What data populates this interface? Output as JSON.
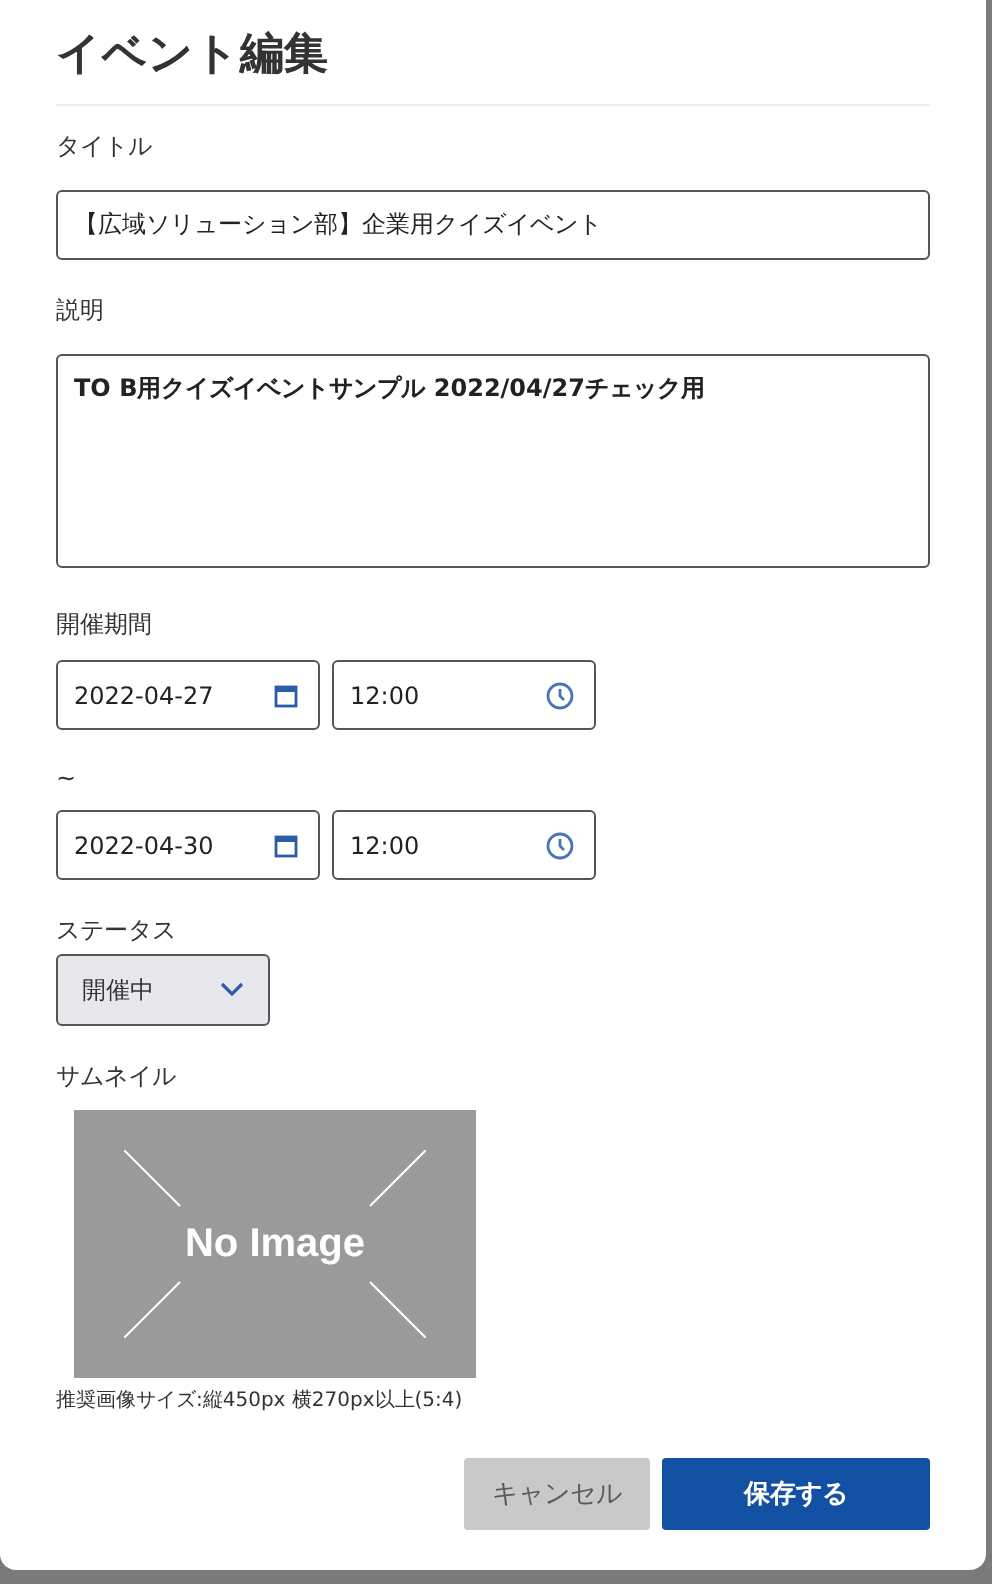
{
  "dialog": {
    "title": "イベント編集"
  },
  "title_field": {
    "label": "タイトル",
    "value": "【広域ソリューション部】企業用クイズイベント"
  },
  "description_field": {
    "label": "説明",
    "value": "TO B用クイズイベントサンプル 2022/04/27チェック用"
  },
  "period": {
    "label": "開催期間",
    "separator": "~",
    "start": {
      "date": "2022-04-27",
      "time": "12:00"
    },
    "end": {
      "date": "2022-04-30",
      "time": "12:00"
    }
  },
  "status": {
    "label": "ステータス",
    "value": "開催中"
  },
  "thumbnail": {
    "label": "サムネイル",
    "placeholder_text": "No Image",
    "note": "推奨画像サイズ:縦450px 横270px以上(5:4)"
  },
  "buttons": [
    {
      "label": "キャンセル",
      "disabled": true
    },
    {
      "label": "保存する",
      "disabled": false
    }
  ]
}
